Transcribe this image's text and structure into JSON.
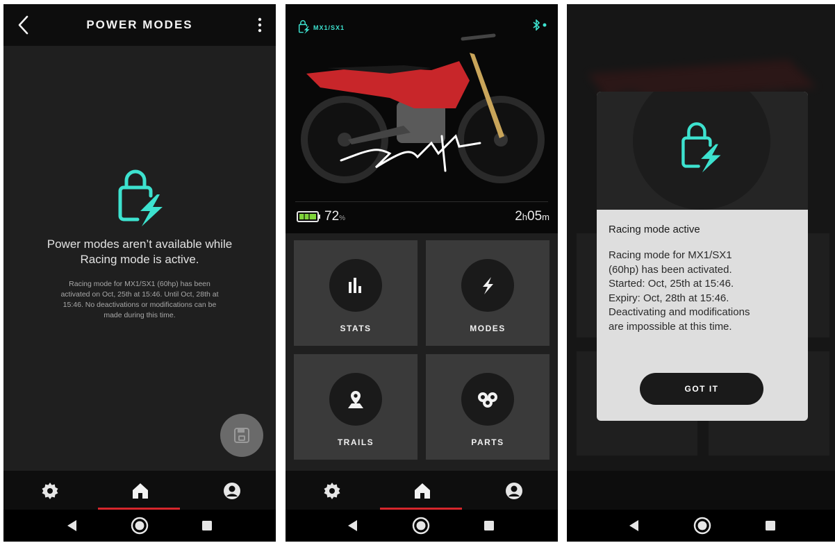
{
  "colors": {
    "accent": "#3de2cf",
    "indicator": "#d6262c",
    "tile": "#3a3a3a",
    "battery": "#7ed33a"
  },
  "power_modes_screen": {
    "title": "POWER MODES",
    "headline": "Power modes aren’t available while Racing mode is active.",
    "description": "Racing mode for MX1/SX1 (60hp) has been activated on Oct, 25th at 15:46. Until Oct, 28th at 15:46. No deactivations or modifications can be made during this time.",
    "icons": {
      "back": "chevron-left-icon",
      "menu": "kebab-icon",
      "lock": "racing-lock-icon",
      "save": "floppy-disk-icon"
    }
  },
  "home_screen": {
    "model": "MX1/SX1",
    "battery_value": "72",
    "battery_unit": "%",
    "battery_level": 0.72,
    "range_hours": "2",
    "range_hours_unit": "h",
    "range_minutes": "05",
    "range_minutes_unit": "m",
    "tiles": [
      {
        "label": "STATS",
        "icon": "bar-chart-icon"
      },
      {
        "label": "MODES",
        "icon": "lightning-icon"
      },
      {
        "label": "TRAILS",
        "icon": "map-pin-icon"
      },
      {
        "label": "PARTS",
        "icon": "chain-link-icon"
      }
    ]
  },
  "racing_modal": {
    "title": "Racing mode active",
    "body_lines": [
      "Racing mode for MX1/SX1",
      "(60hp) has been activated.",
      "Started: Oct, 25th at 15:46.",
      "Expiry: Oct, 28th at 15:46.",
      "Deactivating and modifications",
      "are impossible at this time."
    ],
    "button": "GOT IT"
  },
  "tabbar": {
    "items": [
      "settings-icon",
      "home-icon",
      "profile-icon"
    ],
    "active": "home-icon"
  },
  "android_nav": {
    "items": [
      "back-triangle-icon",
      "home-circle-icon",
      "recents-square-icon"
    ]
  }
}
